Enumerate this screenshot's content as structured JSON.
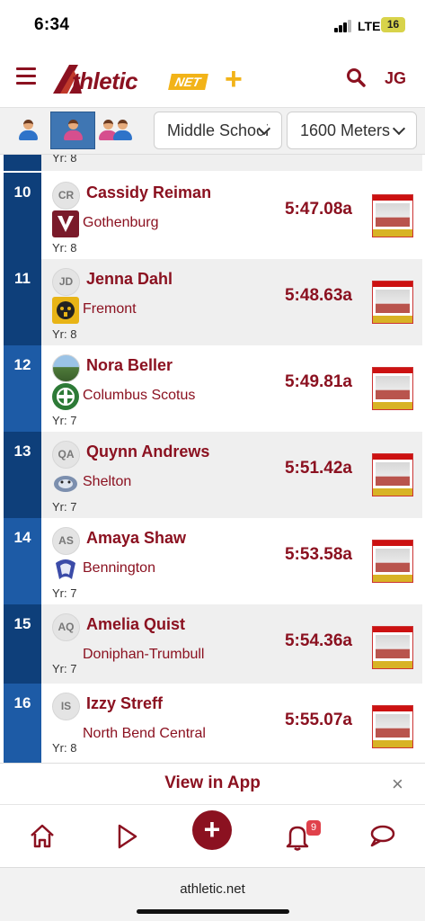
{
  "status_bar": {
    "time": "6:34",
    "network": "LTE",
    "battery": "16"
  },
  "header": {
    "logo_text": "thletic",
    "logo_net": "NET",
    "logo_plus": "+",
    "user_initials": "JG"
  },
  "filters": {
    "level": "Middle School",
    "event": "1600 Meters"
  },
  "partial_row": {
    "year": "Yr: 8"
  },
  "results": [
    {
      "rank": "10",
      "initials": "CR",
      "name": "Cassidy Reiman",
      "team": "Gothenburg",
      "year": "Yr: 8",
      "mark": "5:47.08a",
      "team_logo_color": "#7a1a2a"
    },
    {
      "rank": "11",
      "initials": "JD",
      "name": "Jenna Dahl",
      "team": "Fremont",
      "year": "Yr: 8",
      "mark": "5:48.63a",
      "team_logo_color": "#e8b416"
    },
    {
      "rank": "12",
      "initials": "",
      "name": "Nora Beller",
      "team": "Columbus Scotus",
      "year": "Yr: 7",
      "mark": "5:49.81a",
      "team_logo_color": "#2d7a37"
    },
    {
      "rank": "13",
      "initials": "QA",
      "name": "Quynn Andrews",
      "team": "Shelton",
      "year": "Yr: 7",
      "mark": "5:51.42a",
      "team_logo_color": "#7c8fae"
    },
    {
      "rank": "14",
      "initials": "AS",
      "name": "Amaya Shaw",
      "team": "Bennington",
      "year": "Yr: 7",
      "mark": "5:53.58a",
      "team_logo_color": "#3b4ba8"
    },
    {
      "rank": "15",
      "initials": "AQ",
      "name": "Amelia Quist",
      "team": "Doniphan-Trumbull",
      "year": "Yr: 7",
      "mark": "5:54.36a",
      "team_logo_color": ""
    },
    {
      "rank": "16",
      "initials": "IS",
      "name": "Izzy Streff",
      "team": "North Bend Central",
      "year": "Yr: 8",
      "mark": "5:55.07a",
      "team_logo_color": ""
    }
  ],
  "app_banner": {
    "text": "View in App",
    "close": "×"
  },
  "bottom_nav": {
    "notification_count": "9"
  },
  "url_bar": {
    "url": "athletic.net"
  }
}
